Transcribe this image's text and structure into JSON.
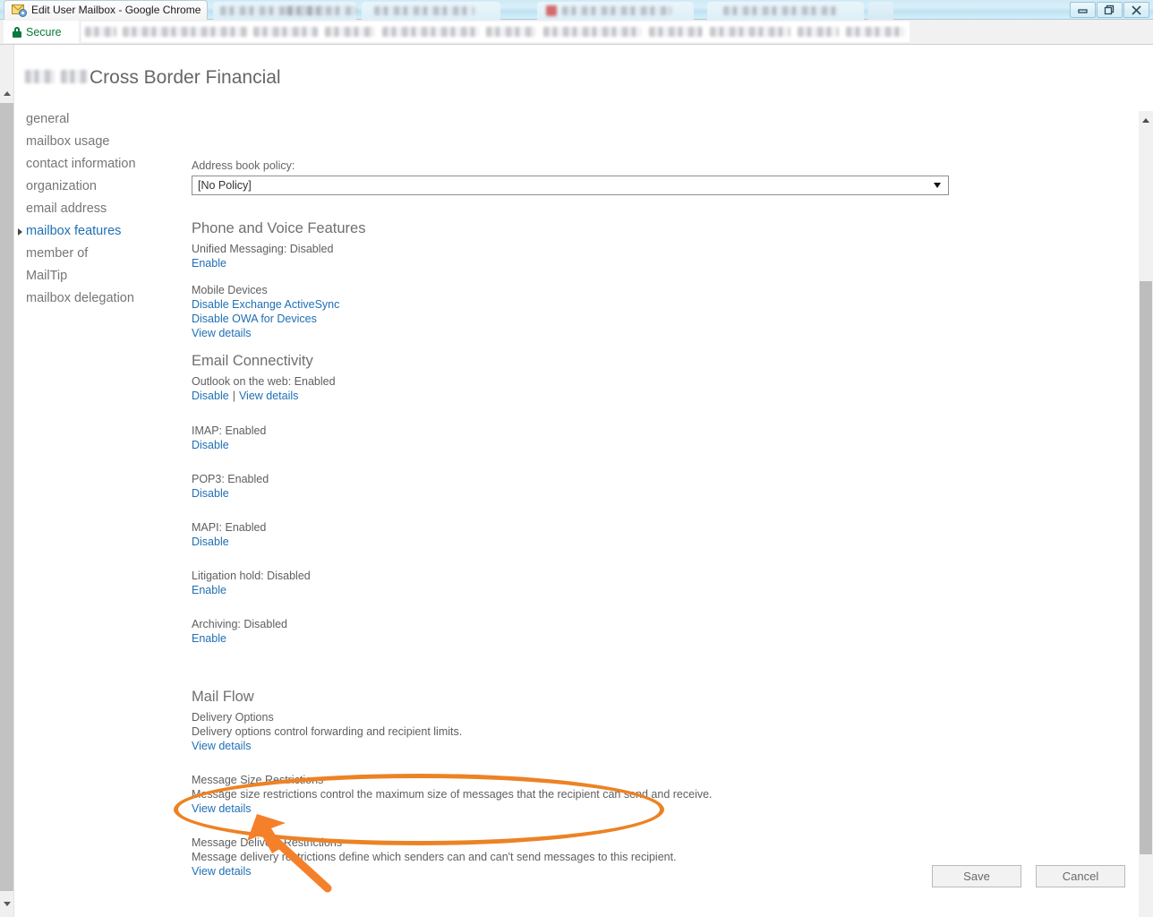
{
  "browser": {
    "tab_title": "Edit User Mailbox - Google Chrome",
    "tab_icon": "mailbox-gear-icon",
    "security_label": "Secure",
    "security_icon": "lock-icon",
    "url_value": "",
    "window_controls": {
      "minimize": "minimize-icon",
      "restore": "restore-icon",
      "close": "close-icon"
    }
  },
  "page": {
    "title": "Cross Border Financial"
  },
  "sidebar": {
    "items": [
      {
        "label": "general",
        "selected": false
      },
      {
        "label": "mailbox usage",
        "selected": false
      },
      {
        "label": "contact information",
        "selected": false
      },
      {
        "label": "organization",
        "selected": false
      },
      {
        "label": "email address",
        "selected": false
      },
      {
        "label": "mailbox features",
        "selected": true
      },
      {
        "label": "member of",
        "selected": false
      },
      {
        "label": "MailTip",
        "selected": false
      },
      {
        "label": "mailbox delegation",
        "selected": false
      }
    ]
  },
  "form": {
    "address_book_policy": {
      "label": "Address book policy:",
      "value": "[No Policy]"
    }
  },
  "sections": {
    "phone_voice": {
      "title": "Phone and Voice Features",
      "unified_messaging_status": "Unified Messaging: Disabled",
      "unified_messaging_action": "Enable",
      "mobile_devices_title": "Mobile Devices",
      "mobile_links": [
        "Disable Exchange ActiveSync",
        "Disable OWA for Devices",
        "View details"
      ]
    },
    "email_connectivity": {
      "title": "Email Connectivity",
      "owa_status": "Outlook on the web: Enabled",
      "owa_disable": "Disable",
      "owa_separator": "|",
      "owa_view": "View details",
      "protocols": [
        {
          "status": "IMAP: Enabled",
          "action": "Disable"
        },
        {
          "status": "POP3: Enabled",
          "action": "Disable"
        },
        {
          "status": "MAPI: Enabled",
          "action": "Disable"
        },
        {
          "status": "Litigation hold: Disabled",
          "action": "Enable"
        },
        {
          "status": "Archiving: Disabled",
          "action": "Enable"
        }
      ]
    },
    "mail_flow": {
      "title": "Mail Flow",
      "items": [
        {
          "name": "Delivery Options",
          "description": "Delivery options control forwarding and recipient limits.",
          "link": "View details"
        },
        {
          "name": "Message Size Restrictions",
          "description": "Message size restrictions control the maximum size of messages that the recipient can send and receive.",
          "link": "View details"
        },
        {
          "name": "Message Delivery Restrictions",
          "description": "Message delivery restrictions define which senders can and can't send messages to this recipient.",
          "link": "View details"
        }
      ]
    }
  },
  "footer": {
    "save_label": "Save",
    "cancel_label": "Cancel"
  },
  "annotation": {
    "color": "#ed8224",
    "shape": "ellipse-highlight",
    "target": "message-delivery-restrictions-view-details"
  }
}
